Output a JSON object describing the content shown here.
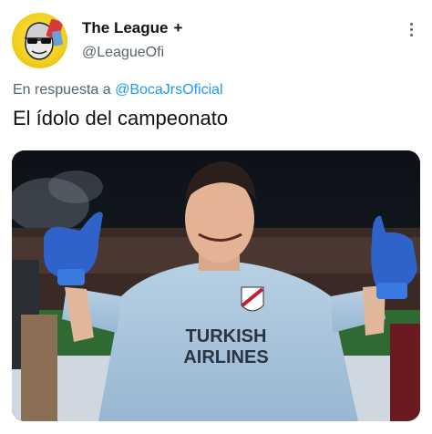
{
  "author": {
    "display_name": "The League",
    "badge": "+",
    "handle": "@LeagueOfi",
    "avatar_icon": "cartoon-face-avatar"
  },
  "menu": {
    "icon": "more-vertical-icon"
  },
  "reply": {
    "prefix": "En respuesta a",
    "mention": "@BocaJrsOficial"
  },
  "tweet": {
    "text": "El ídolo del campeonato"
  },
  "media": {
    "shirt_sponsor_line1": "TURKISH",
    "shirt_sponsor_line2": "AIRLINES"
  },
  "colors": {
    "link": "#1d9bf0",
    "secondary_text": "#536471",
    "primary_text": "#0f1419"
  }
}
